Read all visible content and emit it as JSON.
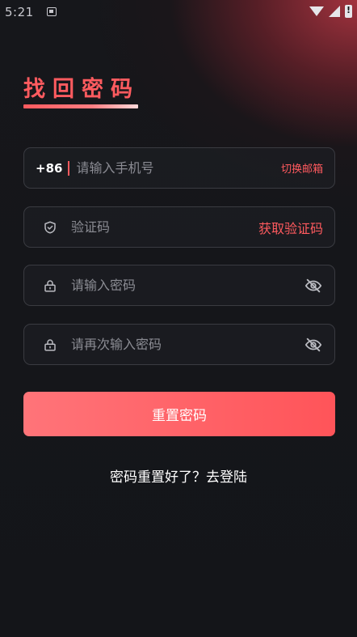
{
  "status_bar": {
    "time": "5:21",
    "icons": [
      "notification-icon",
      "wifi-icon",
      "cellular-icon",
      "battery-icon"
    ]
  },
  "page": {
    "title": "找回密码"
  },
  "form": {
    "phone": {
      "country_code": "+86",
      "placeholder": "请输入手机号",
      "value": "",
      "switch_label": "切换邮箱"
    },
    "code": {
      "placeholder": "验证码",
      "value": "",
      "get_code_label": "获取验证码",
      "icon": "shield-icon"
    },
    "password": {
      "placeholder": "请输入密码",
      "value": "",
      "icon": "lock-icon",
      "toggle_icon": "eye-off-icon"
    },
    "password_confirm": {
      "placeholder": "请再次输入密码",
      "value": "",
      "icon": "lock-icon",
      "toggle_icon": "eye-off-icon"
    },
    "submit_label": "重置密码"
  },
  "footer": {
    "login_link": "密码重置好了？去登陆"
  },
  "colors": {
    "accent": "#ff5a5e",
    "background": "#141519",
    "field_border": "#3a3b41",
    "placeholder": "#8b8c93"
  }
}
